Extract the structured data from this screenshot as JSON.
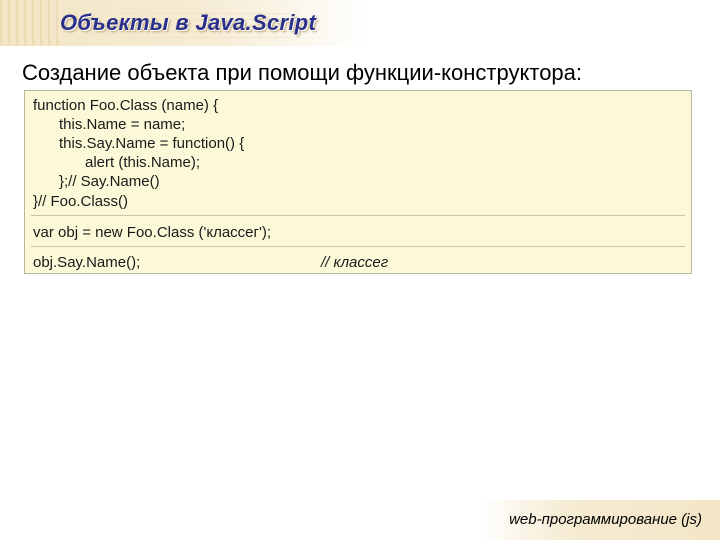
{
  "slide": {
    "title": "Объекты в Java.Script",
    "heading": "Создание объекта при помощи функции-конструктора:",
    "code": {
      "lines": [
        "function Foo.Class (name) {",
        "this.Name = name;",
        "this.Say.Name = function() {",
        "alert (this.Name);",
        "};// Say.Name()",
        "}// Foo.Class()"
      ],
      "var_line": "var obj = new Foo.Class ('классег');",
      "call_line": "obj.Say.Name();",
      "call_comment": "// классег"
    },
    "footer": "web-программирование (js)"
  }
}
